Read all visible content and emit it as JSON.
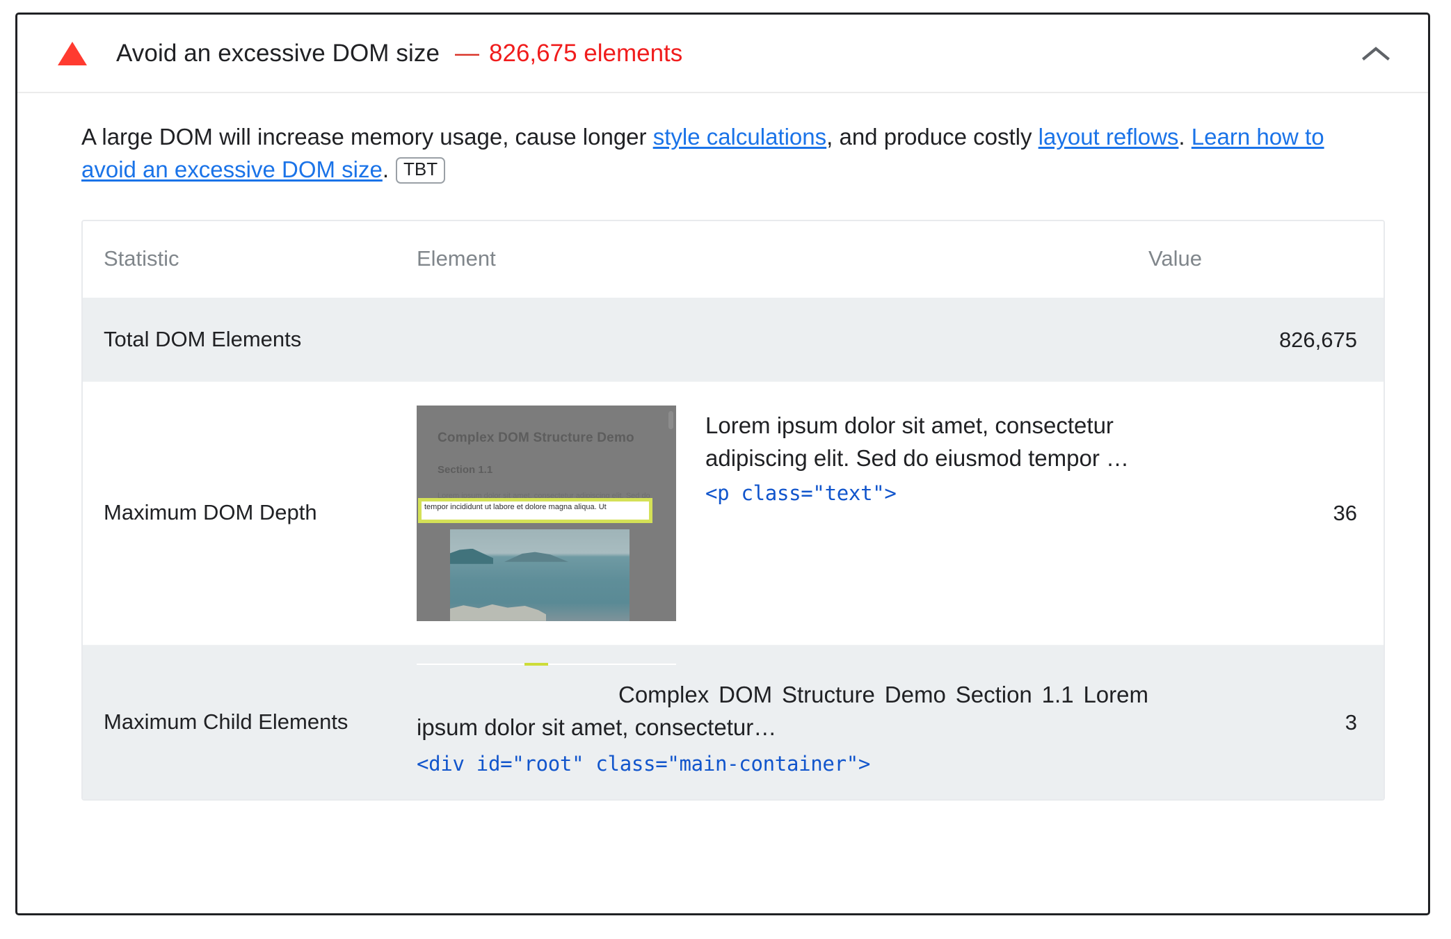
{
  "audit": {
    "status_icon": "warning-triangle-icon",
    "title": "Avoid an excessive DOM size",
    "separator": "—",
    "metric": "826,675 elements",
    "collapse_icon": "chevron-up-icon",
    "accent_warning": "#ff3b30",
    "accent_metric": "#f01c1c",
    "accent_link": "#1a73e8",
    "description": {
      "part1": "A large DOM will increase memory usage, cause longer ",
      "link1": "style calculations",
      "part2": ", and produce costly ",
      "link2": "layout reflows",
      "part3": ". ",
      "link3": "Learn how to avoid an excessive DOM size",
      "part4": ".",
      "badge": "TBT"
    }
  },
  "table": {
    "headers": {
      "statistic": "Statistic",
      "element": "Element",
      "value": "Value"
    },
    "rows": [
      {
        "statistic": "Total DOM Elements",
        "element_text": "",
        "element_code": "",
        "value": "826,675"
      },
      {
        "statistic": "Maximum DOM Depth",
        "element_text": "Lorem ipsum dolor sit amet, consectetur adipiscing elit. Sed do eiusmod tempor …",
        "element_code": "<p class=\"text\">",
        "value": "36",
        "thumbnail": {
          "heading": "Complex DOM Structure Demo",
          "subheading": "Section 1.1",
          "paragraph": "Lorem ipsum dolor sit amet, consectetur adipiscing elit. Sed do eiusmod",
          "highlighted_text": "tempor incididunt ut labore et dolore magna aliqua. Ut",
          "highlight_color": "#d4e157"
        }
      },
      {
        "statistic": "Maximum Child Elements",
        "element_text": "Complex DOM Structure Demo Section 1.1 Lorem ipsum dolor sit amet, consectetur…",
        "element_code": "<div id=\"root\" class=\"main-container\">",
        "value": "3"
      }
    ]
  }
}
